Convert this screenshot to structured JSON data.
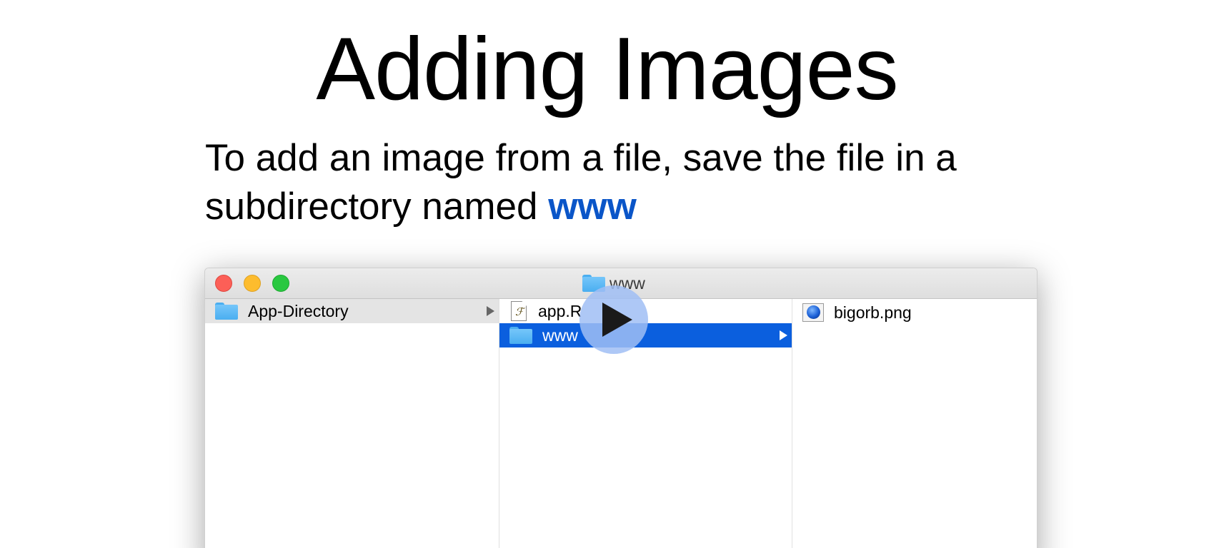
{
  "slide": {
    "title": "Adding Images",
    "body_line1": "To add an image from a file, save the file in a",
    "body_line2_prefix": "subdirectory named ",
    "body_highlight": "www"
  },
  "window": {
    "title": "www",
    "columns": [
      {
        "items": [
          {
            "label": "App-Directory",
            "icon": "folder-icon",
            "state": "parent-selected",
            "has_children": true
          }
        ]
      },
      {
        "items": [
          {
            "label": "app.R",
            "icon": "r-file-icon",
            "state": "normal",
            "has_children": false
          },
          {
            "label": "www",
            "icon": "folder-icon",
            "state": "selected",
            "has_children": true
          }
        ]
      },
      {
        "items": [
          {
            "label": "bigorb.png",
            "icon": "image-file-icon",
            "state": "normal",
            "has_children": false
          }
        ]
      }
    ]
  },
  "colors": {
    "highlight_text": "#0a55c8",
    "selection": "#0b5fde",
    "close": "#fc5f57",
    "minimize": "#fdbc2e",
    "zoom": "#29c840"
  },
  "video": {
    "play_icon": "play-icon"
  }
}
